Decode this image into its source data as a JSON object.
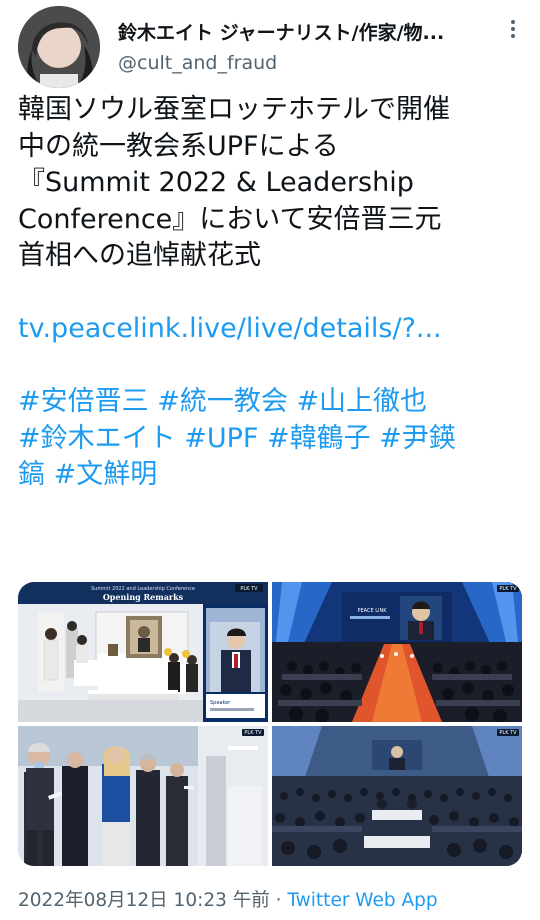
{
  "author": {
    "display_name": "鈴木エイト ジャーナリスト/作家/物...",
    "handle": "@cult_and_fraud",
    "avatar_icon": "profile-avatar",
    "more_icon": "more-vertical-icon"
  },
  "tweet": {
    "text_lines": [
      "韓国ソウル蚕室ロッテホテルで開催",
      "中の統一教会系UPFによる",
      "『Summit 2022 & Leadership",
      "Conference』において安倍晋三元",
      "首相への追悼献花式"
    ],
    "link": "tv.peacelink.live/live/details/?...",
    "hashtag_lines": [
      [
        "#安倍晋三",
        "#統一教会",
        "#山上徹也"
      ],
      [
        "#鈴木エイト",
        "#UPF",
        "#韓鶴子",
        "#尹鍈"
      ],
      [
        "鎬",
        "#文鮮明"
      ]
    ]
  },
  "media": {
    "images": [
      {
        "alt": "photo-opening-remarks",
        "banner": "Summit 2022 and Leadership Conference",
        "heading": "Opening Remarks",
        "badge": "PLK TV",
        "caption": "Speaker"
      },
      {
        "alt": "photo-stage-memorial",
        "badge": "PLK TV",
        "stage_label": "PEACE LINK"
      },
      {
        "alt": "photo-flower-offering",
        "badge": "PLK TV"
      },
      {
        "alt": "photo-ballroom-audience",
        "badge": "PLK TV"
      }
    ]
  },
  "meta": {
    "timestamp": "2022年08月12日 10:23 午前",
    "separator": "·",
    "source": "Twitter Web App"
  },
  "colors": {
    "text": "#0f1419",
    "secondary": "#536471",
    "link": "#1d9bf0"
  }
}
